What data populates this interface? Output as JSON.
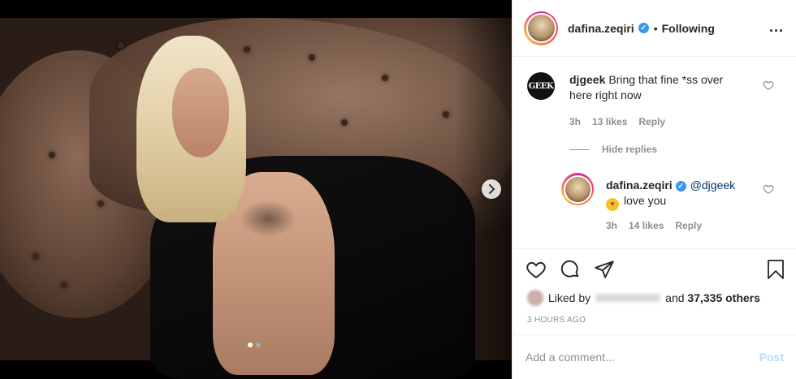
{
  "header": {
    "username": "dafina.zeqiri",
    "verified_mark": "✓",
    "separator": "•",
    "follow_status": "Following",
    "more_label": "..."
  },
  "comments": [
    {
      "avatar_text": "GEEK",
      "username": "djgeek",
      "text": "Bring that fine *ss over here right now",
      "time": "3h",
      "likes": "13 likes",
      "reply": "Reply"
    }
  ],
  "hide_replies": "Hide replies",
  "reply": {
    "username": "dafina.zeqiri",
    "mention": "@djgeek",
    "emoji": "♥",
    "text": "love you",
    "time": "3h",
    "likes": "14 likes",
    "reply": "Reply"
  },
  "likes": {
    "prefix": "Liked by",
    "and": "and",
    "count": "37,335 others"
  },
  "timestamp": "3 HOURS AGO",
  "add_comment": {
    "placeholder": "Add a comment...",
    "post_label": "Post"
  },
  "carousel": {
    "total": 2,
    "current": 1
  },
  "icons": {
    "like": "heart-icon",
    "comment": "comment-icon",
    "share": "share-icon",
    "save": "bookmark-icon",
    "next": "chevron-right-icon"
  }
}
